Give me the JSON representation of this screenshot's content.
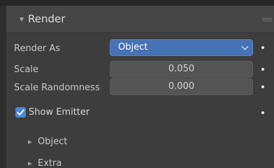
{
  "panel": {
    "title": "Render"
  },
  "properties": {
    "render_as": {
      "label": "Render As",
      "value": "Object"
    },
    "scale": {
      "label": "Scale",
      "value": "0.050"
    },
    "scale_randomness": {
      "label": "Scale Randomness",
      "value": "0.000"
    },
    "show_emitter": {
      "label": "Show Emitter",
      "checked": true
    }
  },
  "subpanels": [
    {
      "title": "Object"
    },
    {
      "title": "Extra"
    }
  ],
  "colors": {
    "accent": "#4772b3",
    "checkbox": "#4a88d8",
    "panel_bg": "#3d3d3d",
    "header_bg": "#454545"
  },
  "icons": {
    "panel_toggle": "triangle-down-icon",
    "dropdown": "chevron-down-icon",
    "checkbox": "checkmark-icon",
    "subpanel_toggle": "triangle-right-icon",
    "animate": "keyframe-dot-icon",
    "grip": "drag-grip-icon"
  }
}
